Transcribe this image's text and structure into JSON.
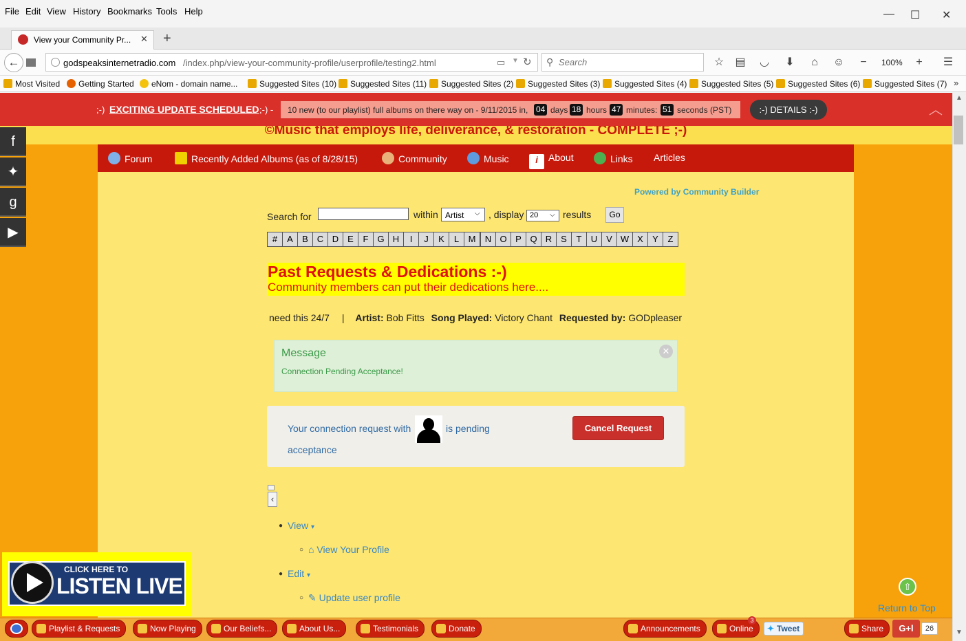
{
  "menu": [
    "File",
    "Edit",
    "View",
    "History",
    "Bookmarks",
    "Tools",
    "Help"
  ],
  "tab": {
    "title": "View your Community Pr...",
    "close": "✕",
    "new_tab": "+"
  },
  "url": {
    "domain": "godspeaksinternetradio.com",
    "path": "/index.php/view-your-community-profile/userprofile/testing2.html"
  },
  "search": {
    "placeholder": "Search"
  },
  "zoom": "100%",
  "bookmarks": [
    "Most Visited",
    "Getting Started",
    "eNom - domain name...",
    "Suggested Sites (10)",
    "Suggested Sites (11)",
    "Suggested Sites (2)",
    "Suggested Sites (3)",
    "Suggested Sites (4)",
    "Suggested Sites (5)",
    "Suggested Sites (6)",
    "Suggested Sites (7)"
  ],
  "banner": {
    "prefix": ";-)",
    "headline": "EXCITING UPDATE SCHEDULED",
    "suffix": ";-) -",
    "countdown_text": "10 new (to our playlist) full albums on there way on - 9/11/2015 in,",
    "days": "04",
    "days_label": "days",
    "hours": "18",
    "hours_label": "hours",
    "minutes": "47",
    "minutes_label": "minutes:",
    "seconds": "51",
    "seconds_label": "seconds (PST)",
    "details": ":-) DETAILS :-)"
  },
  "site_tagline": "©Music that employs life, deliverance, & restoration - COMPLETE ;-)",
  "nav": [
    "Forum",
    "Recently Added Albums (as of 8/28/15)",
    "Community",
    "Music",
    "About",
    "Links",
    "Articles"
  ],
  "powered_by": "Powered by Community Builder",
  "searchform": {
    "search_for": "Search for",
    "within": "within",
    "within_value": "Artist",
    "display": ", display",
    "display_value": "20",
    "results": "results",
    "go": "Go"
  },
  "alphabet": [
    "#",
    "A",
    "B",
    "C",
    "D",
    "E",
    "F",
    "G",
    "H",
    "I",
    "J",
    "K",
    "L",
    "M",
    "N",
    "O",
    "P",
    "Q",
    "R",
    "S",
    "T",
    "U",
    "V",
    "W",
    "X",
    "Y",
    "Z"
  ],
  "dedications": {
    "title": "Past Requests & Dedications :-)",
    "subtitle": "Community members can put their dedications here...."
  },
  "request_row": {
    "note": "need this 24/7",
    "sep": "|",
    "artist_label": "Artist:",
    "artist": "Bob Fitts",
    "song_label": "Song Played:",
    "song": "Victory Chant",
    "requested_label": "Requested by:",
    "requested": "GODpleaser"
  },
  "message": {
    "title": "Message",
    "body": "Connection Pending Acceptance!"
  },
  "connection": {
    "text_before": "Your connection request with",
    "text_after": "is pending",
    "text_line2": "acceptance",
    "cancel": "Cancel Request"
  },
  "profile_menu": {
    "collapse": "‹",
    "view": "View",
    "view_profile": "View Your Profile",
    "edit": "Edit",
    "update_profile": "Update user profile"
  },
  "return_top": "Return to Top",
  "listen_live": {
    "small": "CLICK HERE TO",
    "big": "LISTEN LIVE"
  },
  "bottom_bar": {
    "buttons": [
      "Playlist & Requests",
      "Now Playing",
      "Our Beliefs...",
      "About Us...",
      "Testimonials",
      "Donate"
    ],
    "announcements": "Announcements",
    "online": "Online",
    "online_count": "3",
    "tweet": "Tweet",
    "share": "Share",
    "gplus": "G+l",
    "gplus_count": "26"
  }
}
